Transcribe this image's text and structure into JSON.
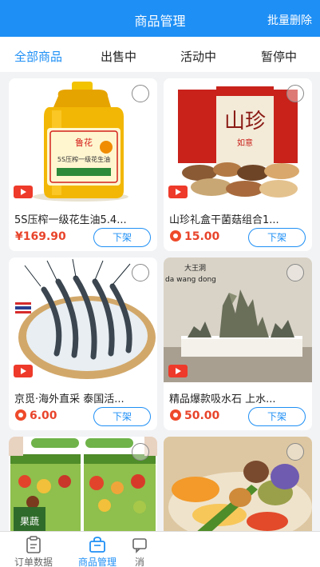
{
  "header": {
    "title": "商品管理",
    "batch_delete": "批量删除"
  },
  "tabs": [
    "全部商品",
    "出售中",
    "活动中",
    "暂停中"
  ],
  "products": [
    {
      "name": "5S压榨一级花生油5.4...",
      "price": "¥169.90",
      "action": "下架",
      "has_video": true,
      "coin": false
    },
    {
      "name": "山珍礼盒干菌菇组合1...",
      "price": "15.00",
      "action": "下架",
      "has_video": true,
      "coin": true
    },
    {
      "name": "京觅·海外直采 泰国活...",
      "price": "6.00",
      "action": "下架",
      "has_video": true,
      "coin": true
    },
    {
      "name": "精品爆款吸水石 上水...",
      "price": "50.00",
      "action": "下架",
      "has_video": true,
      "coin": true
    }
  ],
  "image_text": {
    "gift_box_title": "山珍",
    "gift_box_sub": "如意",
    "stone_sign": "大王洞",
    "stone_pinyin": "da wang dong",
    "oil_label": "5S压榨一级花生油",
    "jar_label": "果蔬"
  },
  "bottom_nav": [
    {
      "label": "订单数据",
      "icon": "clipboard-icon",
      "active": false
    },
    {
      "label": "商品管理",
      "icon": "bag-icon",
      "active": true
    },
    {
      "label": "消",
      "icon": "message-icon",
      "active": false
    }
  ],
  "colors": {
    "brand": "#1e8ff5",
    "price": "#e8442b",
    "video_badge": "#ee3a2a"
  }
}
